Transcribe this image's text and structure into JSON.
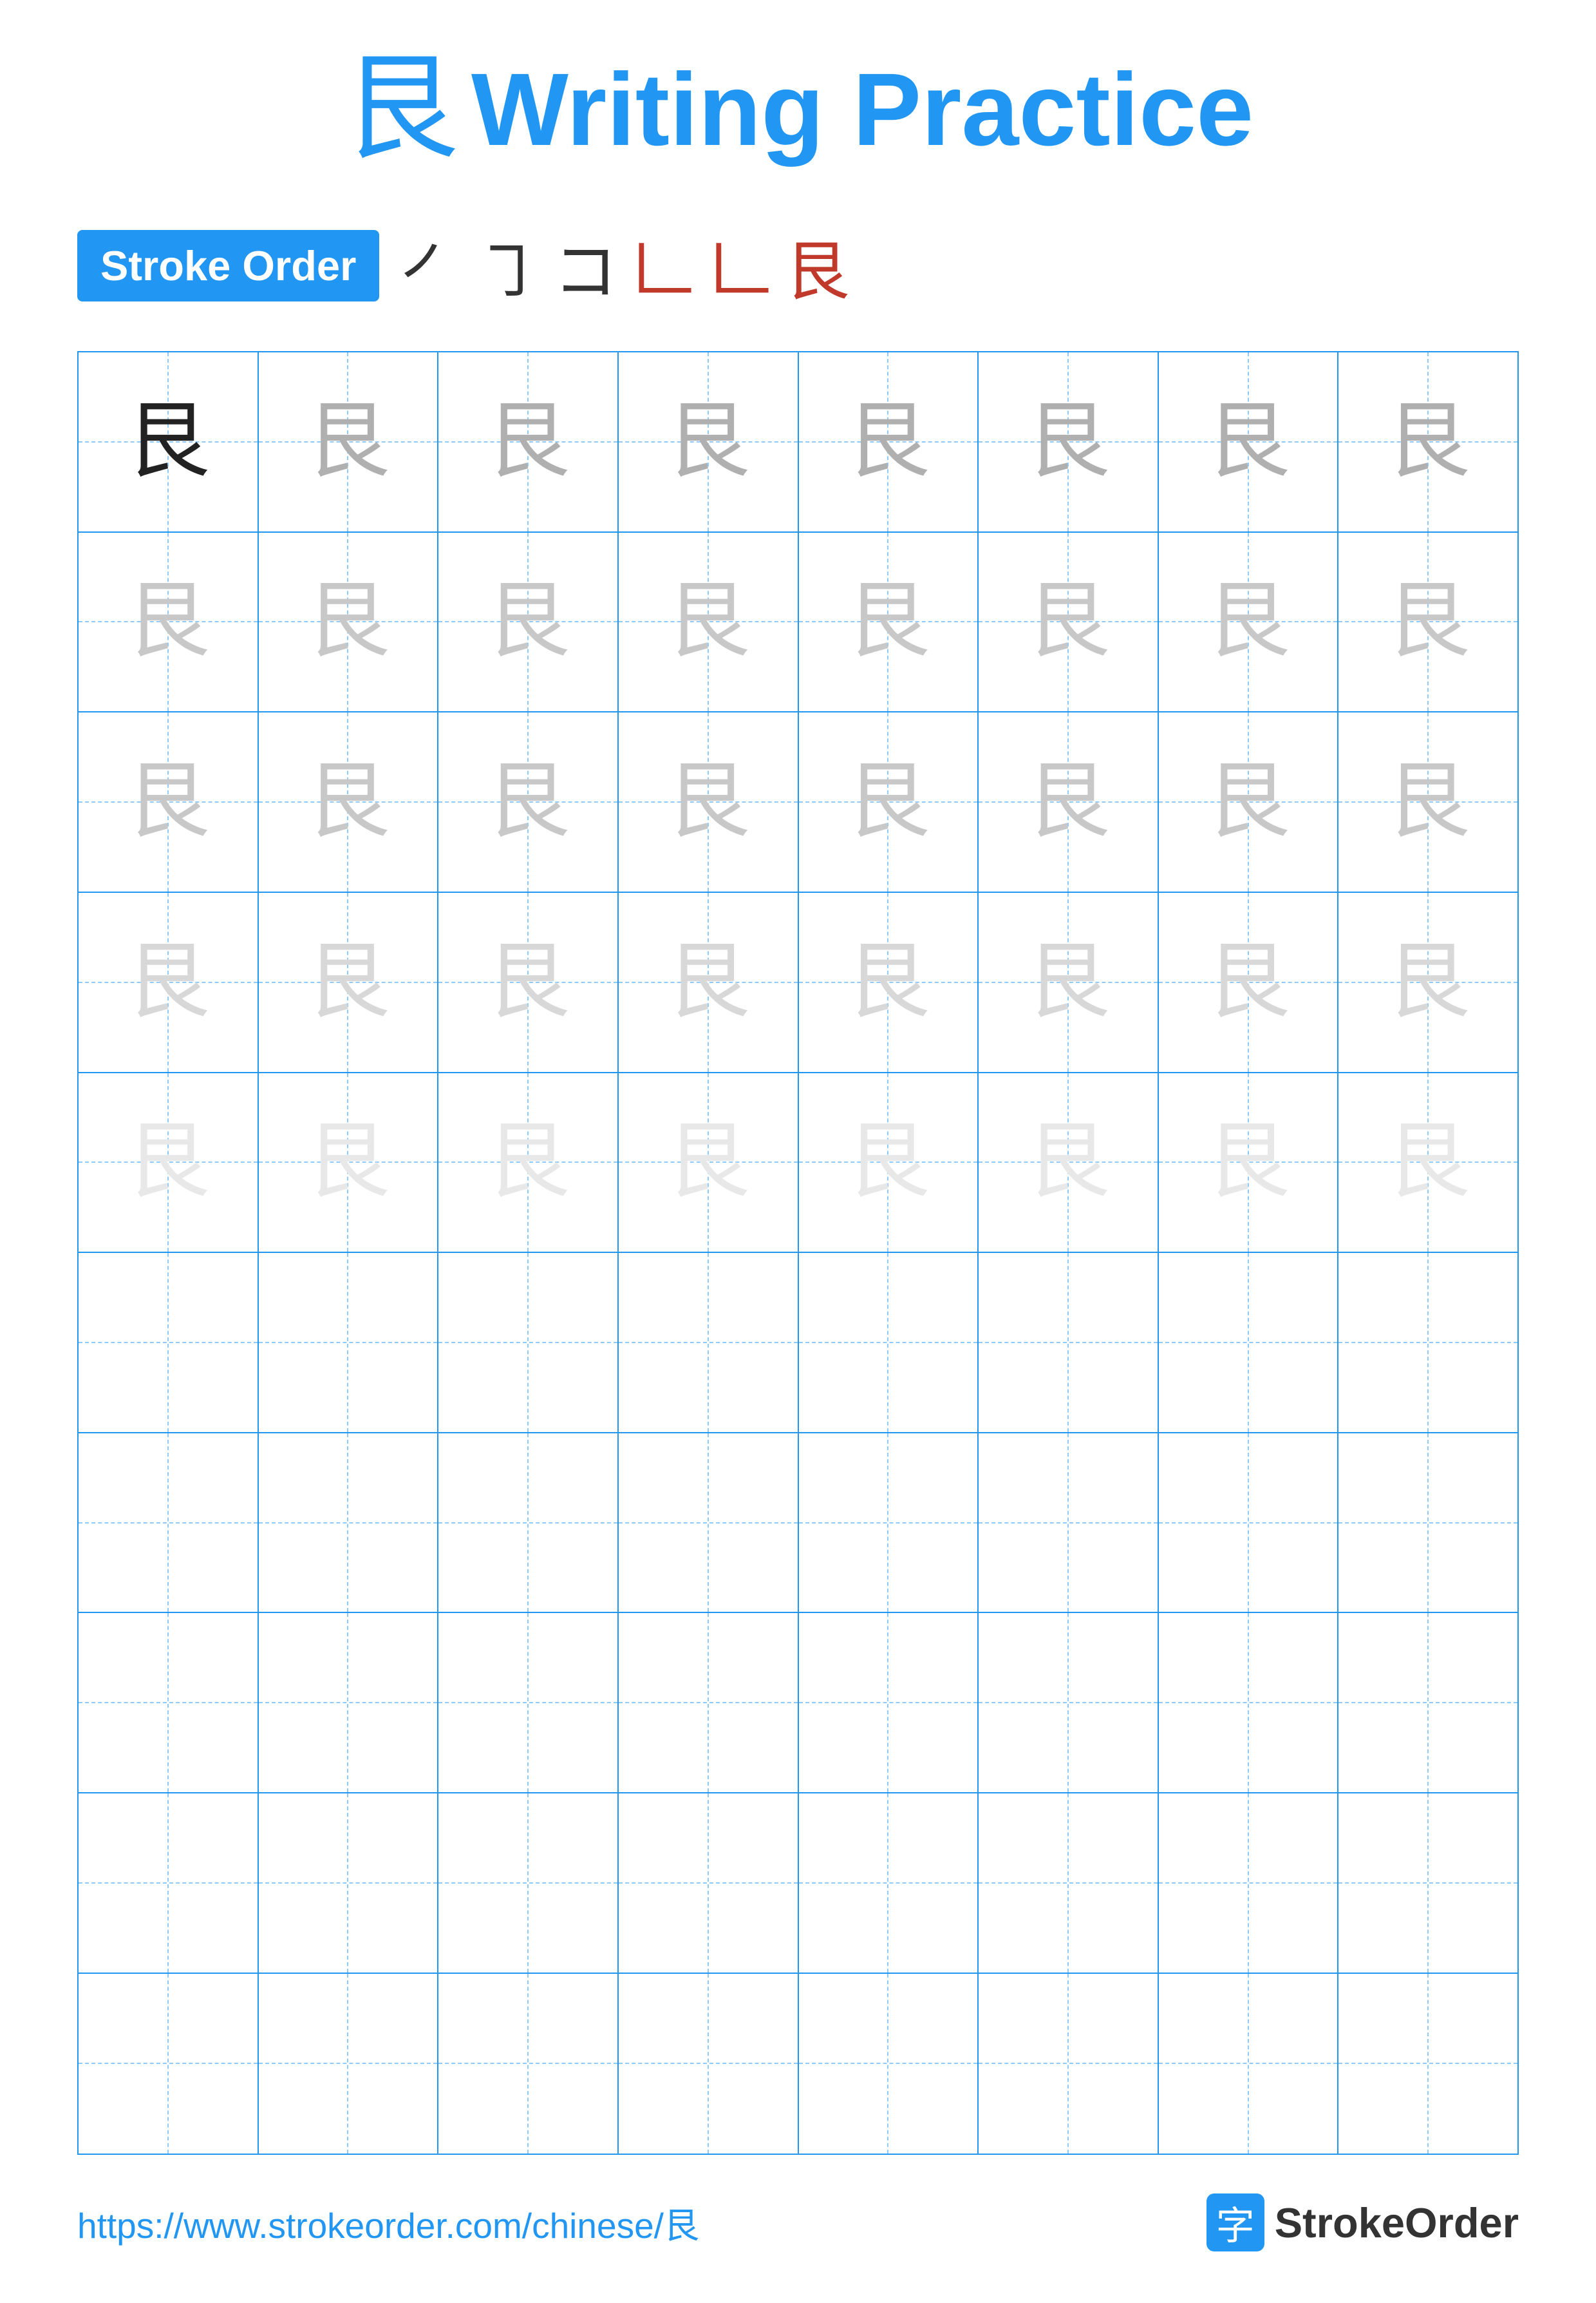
{
  "title": {
    "char": "艮",
    "text": "Writing Practice"
  },
  "stroke_order": {
    "badge_label": "Stroke Order",
    "chars": [
      "㇒",
      "㇆",
      "コ",
      "𠃊",
      "𠃊",
      "艮"
    ]
  },
  "grid": {
    "cols": 8,
    "rows": 10,
    "character": "艮",
    "filled_rows": 5,
    "row_opacities": [
      "dark",
      "gray1",
      "gray2",
      "gray3",
      "gray4"
    ]
  },
  "footer": {
    "url": "https://www.strokeorder.com/chinese/艮",
    "logo_char": "字",
    "logo_name": "StrokeOrder"
  }
}
